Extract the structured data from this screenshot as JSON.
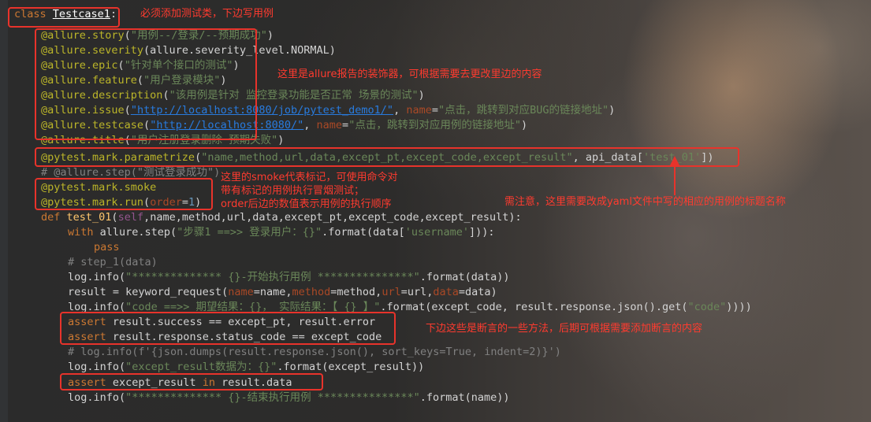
{
  "code_lines": {
    "l1": {
      "kw": "class",
      "name": "Testcase1",
      "colon": ":"
    },
    "l2": {
      "dec": "@allure.story",
      "p1": "(",
      "s": "\"用例--/登录/--预期成功\"",
      "p2": ")"
    },
    "l3": {
      "dec": "@allure.severity",
      "rest": "(allure.severity_level.NORMAL)"
    },
    "l4": {
      "dec": "@allure.epic",
      "p1": "(",
      "s": "\"针对单个接口的测试\"",
      "p2": ")"
    },
    "l5": {
      "dec": "@allure.feature",
      "p1": "(",
      "s": "\"用户登录模块\"",
      "p2": ")"
    },
    "l6": {
      "dec": "@allure.description",
      "p1": "(",
      "s": "\"该用例是针对 监控登录功能是否正常 场景的测试\"",
      "p2": ")"
    },
    "l7": {
      "dec": "@allure.issue",
      "p1": "(",
      "url": "\"http://localhost:8080/job/pytest_demo1/\"",
      "c1": ", ",
      "par": "name",
      "eq": "=",
      "s": "\"点击，跳转到对应BUG的链接地址\"",
      "p2": ")"
    },
    "l8": {
      "dec": "@allure.testcase",
      "p1": "(",
      "url": "\"http://localhost:8080/\"",
      "c1": ", ",
      "par": "name",
      "eq": "=",
      "s": "\"点击，跳转到对应用例的链接地址\"",
      "p2": ")"
    },
    "l9": {
      "dec": "@allure.title",
      "p1": "(",
      "s": "\"用户注册登录删除 预期失败\"",
      "p2": ")"
    },
    "l10": {
      "dec": "@pytest.mark.parametrize",
      "p1": "(",
      "s": "\"name,method,url,data,except_pt,except_code,except_result\"",
      "c1": ", api_data[",
      "s2": "'test_01'",
      "p2": "])"
    },
    "l11": {
      "cmt": "# @allure.step(\"测试登录成功\")"
    },
    "l12": {
      "dec": "@pytest.mark.smoke"
    },
    "l13": {
      "dec": "@pytest.mark.run",
      "p1": "(",
      "par": "order",
      "eq": "=",
      "num": "1",
      "p2": ")"
    },
    "l14": {
      "kw": "def ",
      "fn": "test_01",
      "p1": "(",
      "self": "self",
      "rest": ",name,method,url,data,except_pt,except_code,except_result):"
    },
    "l15": {
      "kw": "with ",
      "a": "allure.step(",
      "s": "\"步骤1 ==>> 登录用户：{}\"",
      "b": ".format(data[",
      "s2": "'username'",
      "c": "])):"
    },
    "l16": {
      "kw": "pass"
    },
    "l17": {
      "cmt": "# step_1(data)"
    },
    "l18": {
      "a": "log.info(",
      "s": "\"************** {}-开始执行用例 ***************\"",
      "b": ".format(data))"
    },
    "l19": {
      "a": "result = keyword_request(",
      "p1": "name",
      "e1": "=name,",
      "p2": "method",
      "e2": "=method,",
      "p3": "url",
      "e3": "=url,",
      "p4": "data",
      "e4": "=data)"
    },
    "l20": {
      "a": "log.info(",
      "s": "\"code ==>> 期望结果：{}， 实际结果：【 {} 】\"",
      "b": ".format(except_code, result.response.json().get(",
      "s2": "\"code\"",
      "c": "))))"
    },
    "l21": {
      "kw": "assert ",
      "rest": "result.success == except_pt, result.error"
    },
    "l22": {
      "kw": "assert ",
      "rest": "result.response.status_code == except_code"
    },
    "l23": {
      "cmt": "# log.info(f'{json.dumps(result.response.json(), sort_keys=True, indent=2)}')"
    },
    "l24": {
      "a": "log.info(",
      "s": "\"except_result数据为：{}\"",
      "b": ".format(except_result))"
    },
    "l25": {
      "kw": "assert ",
      "a": "except_result ",
      "kw2": "in",
      "b": " result.data"
    },
    "l26": {
      "a": "log.info(",
      "s": "\"************** {}-结束执行用例 ***************\"",
      "b": ".format(name))"
    }
  },
  "annotations": {
    "class_note": "必须添加测试类，下边写用例",
    "allure_note": "这里是allure报告的装饰器，可根据需要去更改里边的内容",
    "smoke_note_1": "这里的smoke代表标记，可使用命令对",
    "smoke_note_2": "带有标记的用例执行冒烟测试；",
    "smoke_note_3": "order后边的数值表示用例的执行顺序",
    "yaml_note": "需注意，这里需要改成yaml文件中写的相应的用例的标题名称",
    "assert_note": "下边这些是断言的一些方法，后期可根据需要添加断言的内容"
  },
  "colors": {
    "annotation_red": "#e8332b",
    "keyword": "#cc7832",
    "decorator": "#bbb529",
    "string": "#6a8759",
    "comment": "#808080"
  }
}
